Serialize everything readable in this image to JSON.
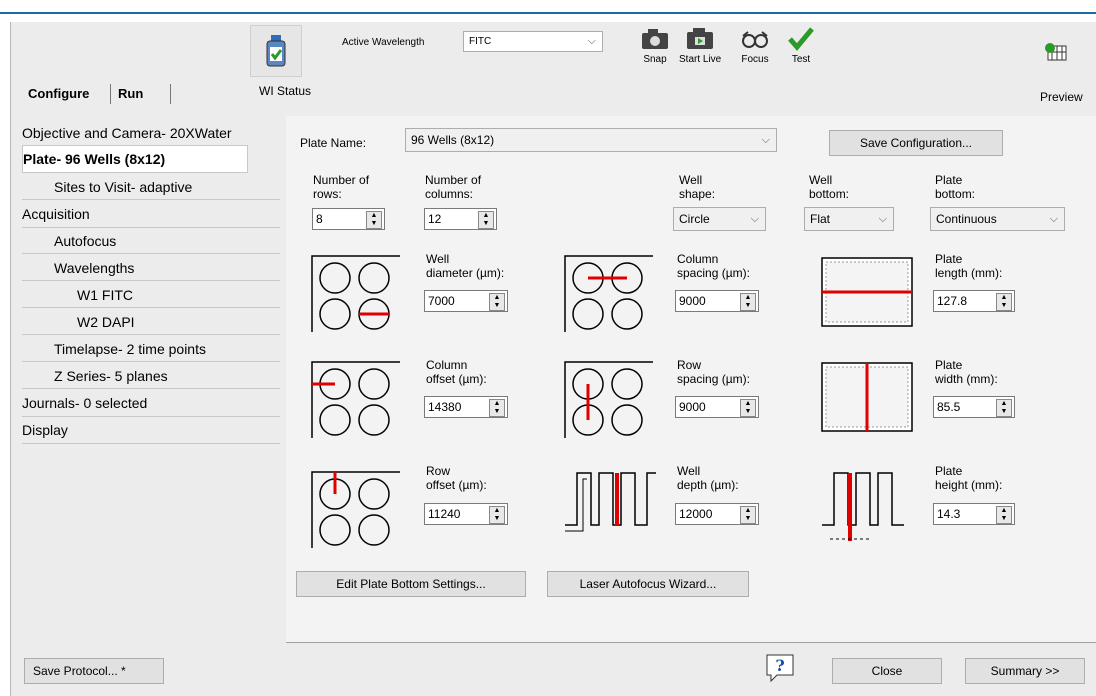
{
  "toolbar": {
    "wl_status": "WI Status",
    "active_wavelength_label": "Active Wavelength",
    "active_wavelength_value": "FITC",
    "snap": "Snap",
    "start_live": "Start Live",
    "focus": "Focus",
    "test": "Test",
    "preview": "Preview"
  },
  "tabs": {
    "configure": "Configure",
    "run": "Run"
  },
  "nav": [
    {
      "label": "Objective and Camera- 20XWater"
    },
    {
      "label": "Plate- 96 Wells (8x12)"
    },
    {
      "label": "Sites to Visit- adaptive"
    },
    {
      "label": "Acquisition"
    },
    {
      "label": "Autofocus"
    },
    {
      "label": "Wavelengths"
    },
    {
      "label": "W1 FITC"
    },
    {
      "label": "W2 DAPI"
    },
    {
      "label": "Timelapse- 2 time points"
    },
    {
      "label": "Z Series- 5 planes"
    },
    {
      "label": "Journals- 0 selected"
    },
    {
      "label": "Display"
    }
  ],
  "plate": {
    "plate_name_label": "Plate Name:",
    "plate_name_value": "96 Wells (8x12)",
    "save_config": "Save Configuration...",
    "rows_label_1": "Number of",
    "rows_label_2": "rows:",
    "rows_value": "8",
    "cols_label_1": "Number of",
    "cols_label_2": "columns:",
    "cols_value": "12",
    "well_shape_label_1": "Well",
    "well_shape_label_2": "shape:",
    "well_shape_value": "Circle",
    "well_bottom_label_1": "Well",
    "well_bottom_label_2": "bottom:",
    "well_bottom_value": "Flat",
    "plate_bottom_label_1": "Plate",
    "plate_bottom_label_2": "bottom:",
    "plate_bottom_value": "Continuous",
    "well_diameter_label_1": "Well",
    "well_diameter_label_2": "diameter (µm):",
    "well_diameter_value": "7000",
    "col_spacing_label_1": "Column",
    "col_spacing_label_2": "spacing (µm):",
    "col_spacing_value": "9000",
    "plate_length_label_1": "Plate",
    "plate_length_label_2": "length (mm):",
    "plate_length_value": "127.8",
    "col_offset_label_1": "Column",
    "col_offset_label_2": "offset (µm):",
    "col_offset_value": "14380",
    "row_spacing_label_1": "Row",
    "row_spacing_label_2": "spacing (µm):",
    "row_spacing_value": "9000",
    "plate_width_label_1": "Plate",
    "plate_width_label_2": "width (mm):",
    "plate_width_value": "85.5",
    "row_offset_label_1": "Row",
    "row_offset_label_2": "offset (µm):",
    "row_offset_value": "11240",
    "well_depth_label_1": "Well",
    "well_depth_label_2": "depth (µm):",
    "well_depth_value": "12000",
    "plate_height_label_1": "Plate",
    "plate_height_label_2": "height (mm):",
    "plate_height_value": "14.3",
    "edit_bottom": "Edit Plate Bottom Settings...",
    "laser_af": "Laser Autofocus Wizard..."
  },
  "footer": {
    "save_protocol": "Save Protocol... *",
    "close": "Close",
    "summary": "Summary >>"
  },
  "colors": {
    "accent": "#e00000",
    "topline": "#1b6aa5",
    "check": "#2a9a2a"
  }
}
